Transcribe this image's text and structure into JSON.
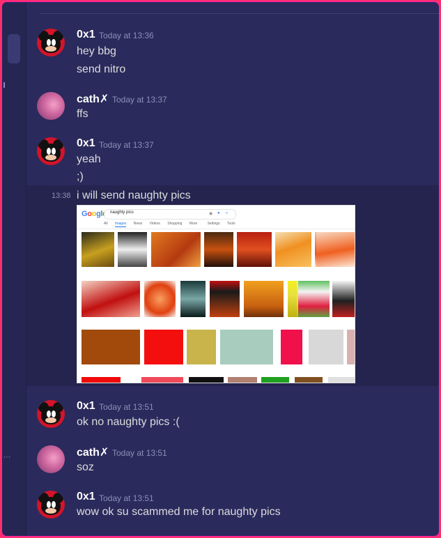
{
  "messages": [
    {
      "user": "0x1",
      "time": "Today at 13:36",
      "lines": [
        "hey bbg",
        "send nitro"
      ]
    },
    {
      "user": "cath✗",
      "time": "Today at 13:37",
      "lines": [
        "ffs"
      ]
    },
    {
      "user": "0x1",
      "time": "Today at 13:37",
      "lines": [
        "yeah",
        ";)"
      ]
    },
    {
      "side_time": "13:38",
      "lines": [
        "i will send naughty pics"
      ]
    },
    {
      "user": "0x1",
      "time": "Today at 13:51",
      "lines": [
        "ok no naughty pics :("
      ]
    },
    {
      "user": "cath✗",
      "time": "Today at 13:51",
      "lines": [
        "soz"
      ]
    },
    {
      "user": "0x1",
      "time": "Today at 13:51",
      "lines": [
        "wow ok su scammed me for naughty pics"
      ]
    }
  ],
  "attachment": {
    "logo": "Google",
    "query": "naughty pics",
    "tabs": [
      "All",
      "Images",
      "News",
      "Videos",
      "Shopping",
      "More",
      "Settings",
      "Tools"
    ],
    "active_tab": "Images"
  },
  "icons": {
    "avatar_0x1": "mickey-mouse-avatar",
    "avatar_cath": "pink-photo-avatar"
  },
  "colors": {
    "background": "#2a2a5c",
    "highlight": "#24244f",
    "border": "#ff2f6e",
    "username": "#ffffff",
    "message_text": "#dcddde",
    "timestamp": "#8e8fb8"
  }
}
